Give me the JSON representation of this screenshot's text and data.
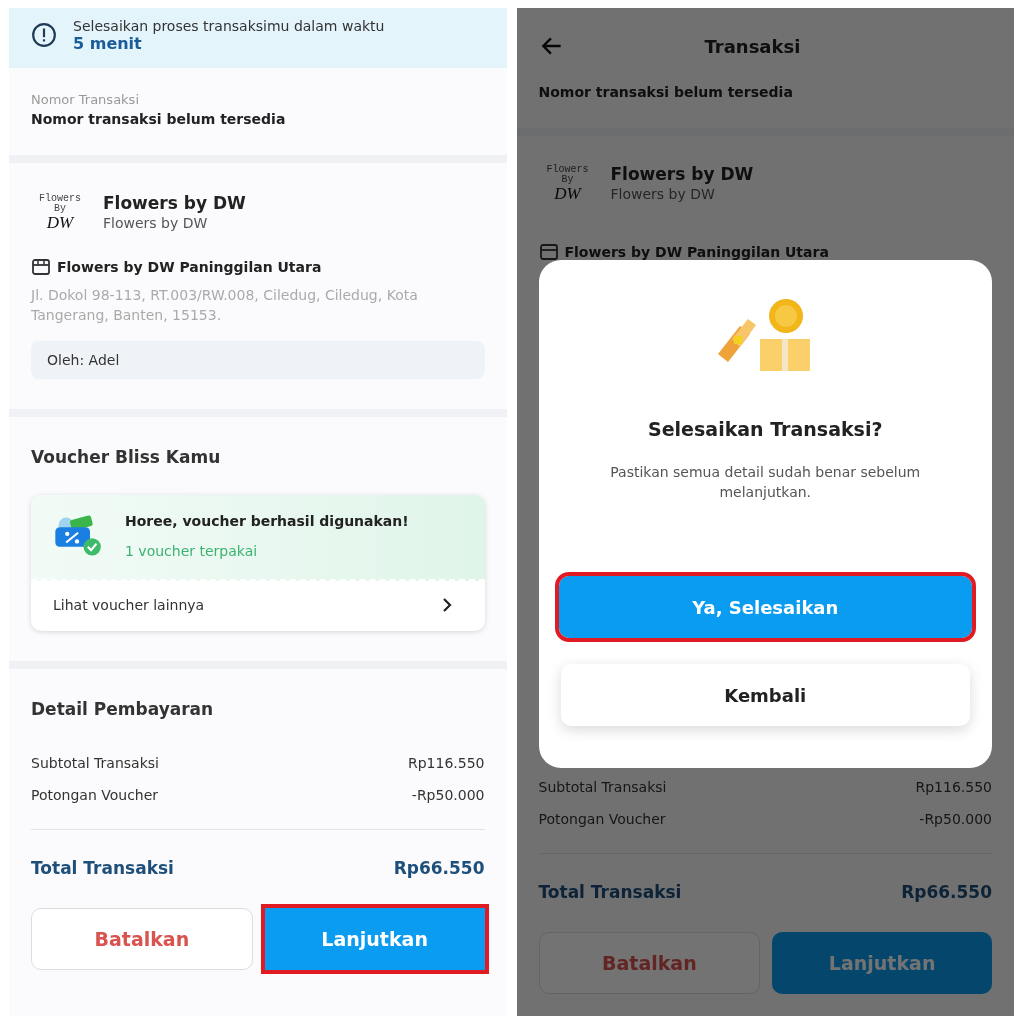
{
  "left_screen": {
    "timer": {
      "message": "Selesaikan proses transaksimu dalam waktu",
      "highlight": "5 menit"
    },
    "transaction": {
      "label": "Nomor Transaksi",
      "value": "Nomor transaksi belum tersedia"
    },
    "merchant": {
      "logo_text": [
        "Flowers",
        "By",
        "DW"
      ],
      "name": "Flowers by DW",
      "subtitle": "Flowers by DW"
    },
    "store": {
      "name": "Flowers by DW Paninggilan Utara",
      "address": "Jl. Dokol 98-113, RT.003/RW.008, Ciledug, Ciledug, Kota Tangerang, Banten, 15153."
    },
    "ordered_by": "Oleh: Adel",
    "voucher": {
      "heading": "Voucher Bliss Kamu",
      "title": "Horee, voucher berhasil digunakan!",
      "status": "1 voucher terpakai",
      "link": "Lihat voucher lainnya"
    },
    "payment": {
      "heading": "Detail Pembayaran",
      "rows": [
        {
          "label": "Subtotal Transaksi",
          "value": "Rp116.550"
        },
        {
          "label": "Potongan Voucher",
          "value": "-Rp50.000"
        }
      ],
      "total": {
        "label": "Total Transaksi",
        "value": "Rp66.550"
      }
    },
    "buttons": [
      {
        "label": "Batalkan",
        "kind": "secondary",
        "highlighted": false
      },
      {
        "label": "Lanjutkan",
        "kind": "primary",
        "highlighted": true
      }
    ]
  },
  "right_screen": {
    "header": {
      "title": "Transaksi"
    },
    "transaction_value": "Nomor transaksi belum tersedia",
    "merchant": {
      "logo_text": [
        "Flowers",
        "By",
        "DW"
      ],
      "name": "Flowers by DW",
      "subtitle": "Flowers by DW"
    },
    "store_name": "Flowers by DW Paninggilan Utara",
    "payment_rows": [
      {
        "label": "Subtotal Transaksi",
        "value": "Rp116.550"
      },
      {
        "label": "Potongan Voucher",
        "value": "-Rp50.000"
      }
    ],
    "total": {
      "label": "Total Transaksi",
      "value": "Rp66.550"
    },
    "buttons": [
      {
        "label": "Batalkan",
        "kind": "secondary",
        "highlighted": false
      },
      {
        "label": "Lanjutkan",
        "kind": "primary",
        "highlighted": false
      }
    ],
    "dialog": {
      "title": "Selesaikan Transaksi?",
      "message": "Pastikan semua detail sudah benar sebelum melanjutkan.",
      "buttons": [
        {
          "label": "Ya, Selesaikan",
          "kind": "primary",
          "highlighted": true
        },
        {
          "label": "Kembali",
          "kind": "secondary",
          "highlighted": false
        }
      ]
    }
  }
}
